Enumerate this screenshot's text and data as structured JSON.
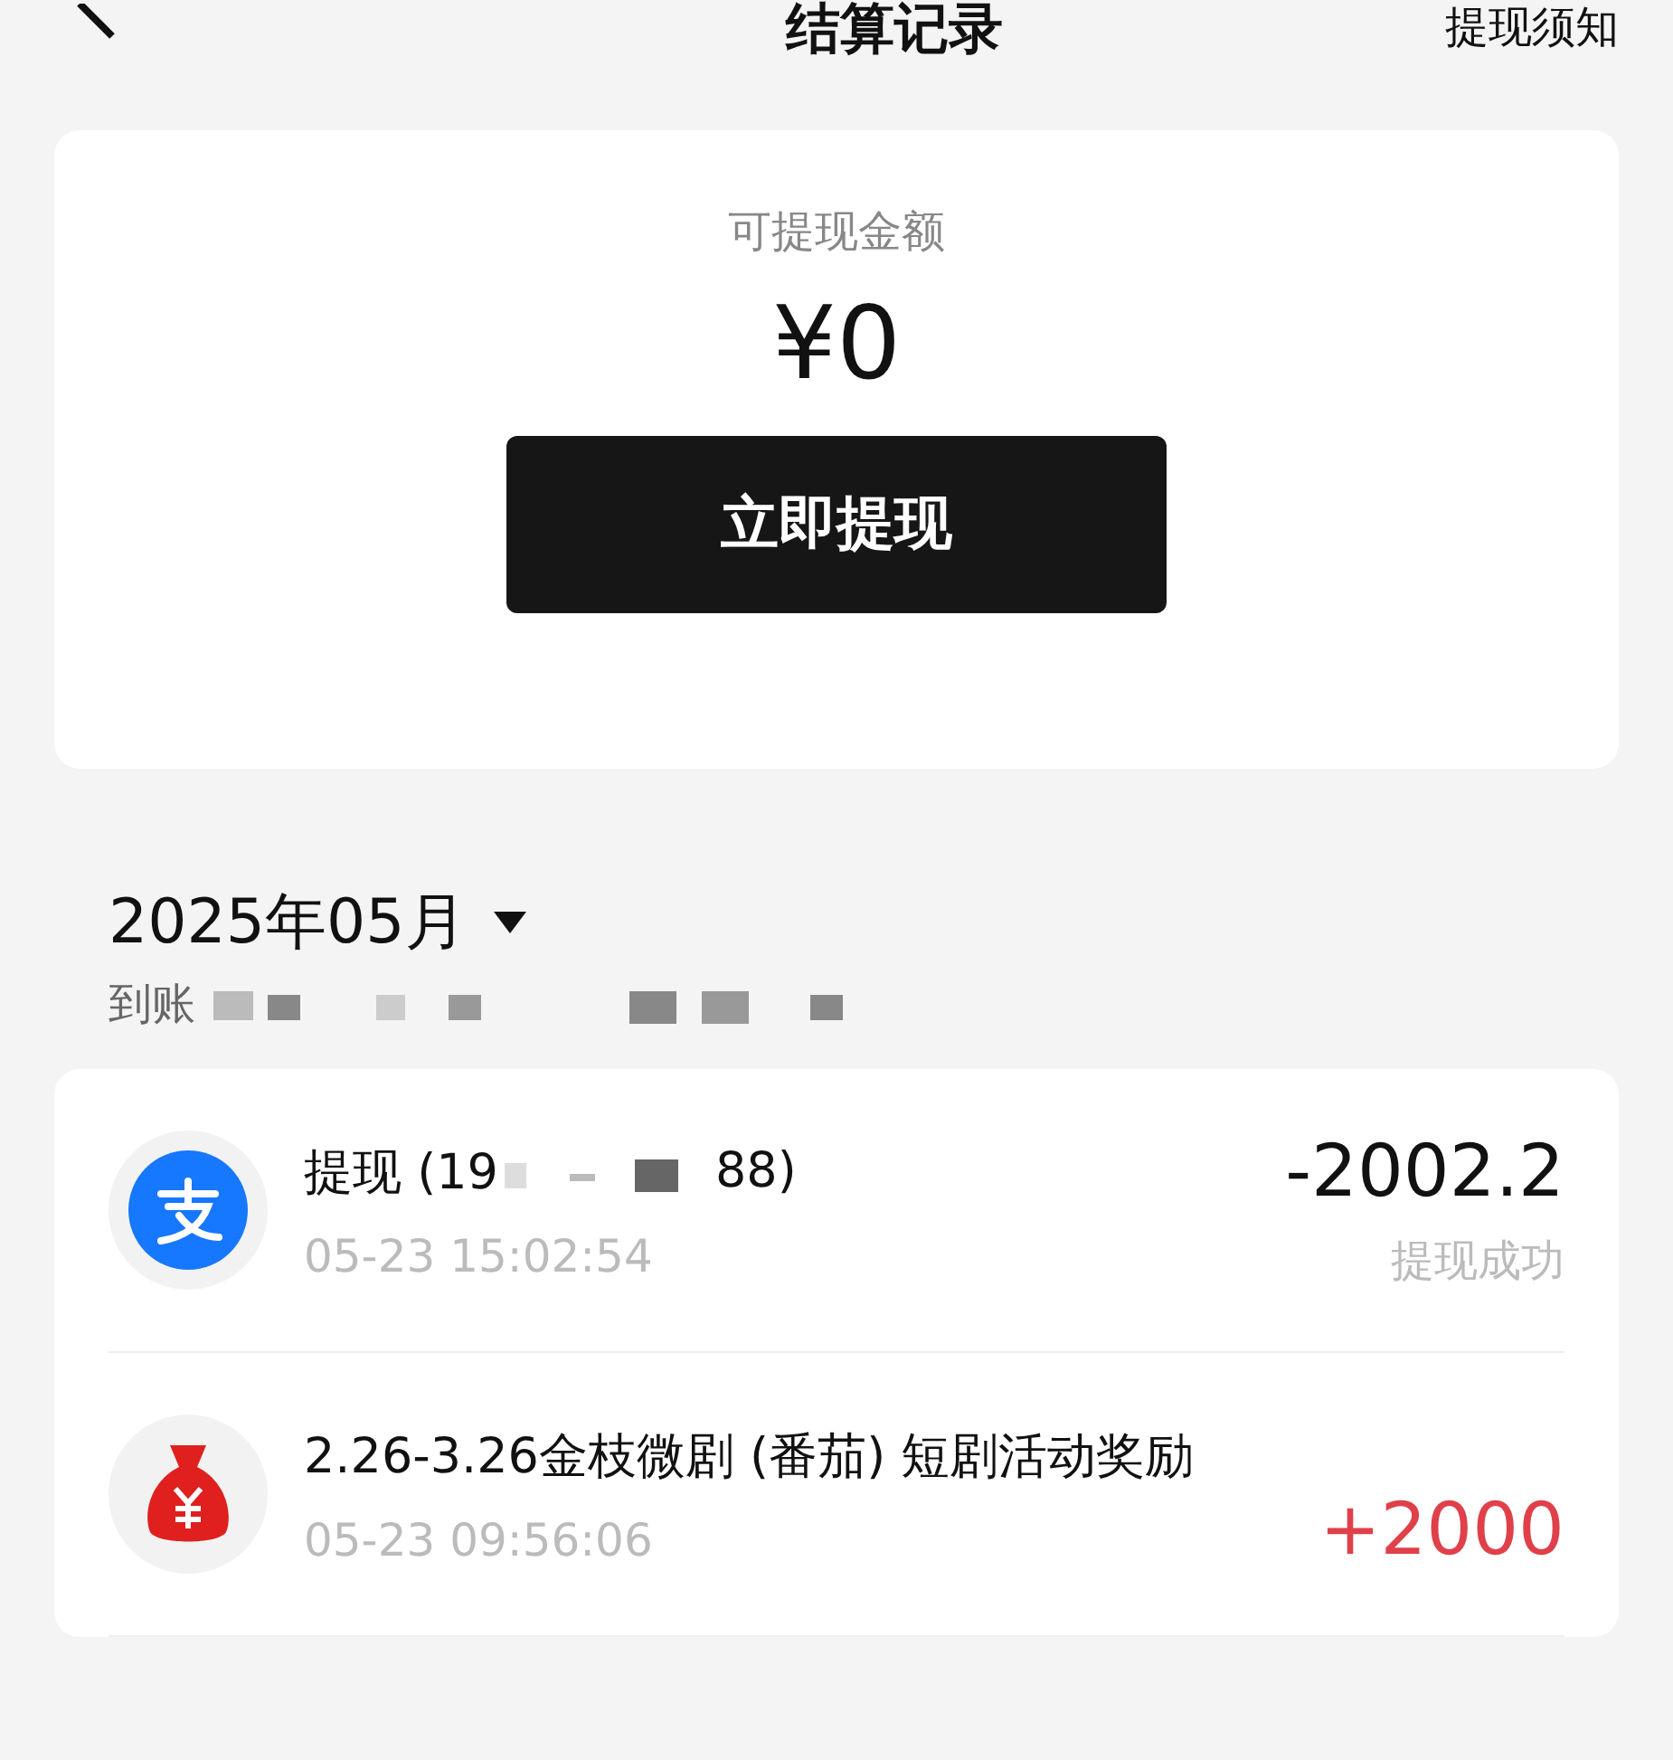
{
  "header": {
    "title": "结算记录",
    "link": "提现须知"
  },
  "balance": {
    "label": "可提现金额",
    "amount": "¥0",
    "button": "立即提现"
  },
  "month": {
    "label": "2025年05月",
    "subtitle": "到账"
  },
  "records": [
    {
      "kind": "withdrawal",
      "title_start": "提现 (19",
      "title_end": "88)",
      "time": "05-23 15:02:54",
      "amount": "-2002.2",
      "status": "提现成功"
    },
    {
      "kind": "reward",
      "title_start": "2.26-3.26金枝微剧 (番茄) 短剧活动奖励",
      "time": "05-23 09:56:06",
      "amount": "+2000"
    }
  ]
}
